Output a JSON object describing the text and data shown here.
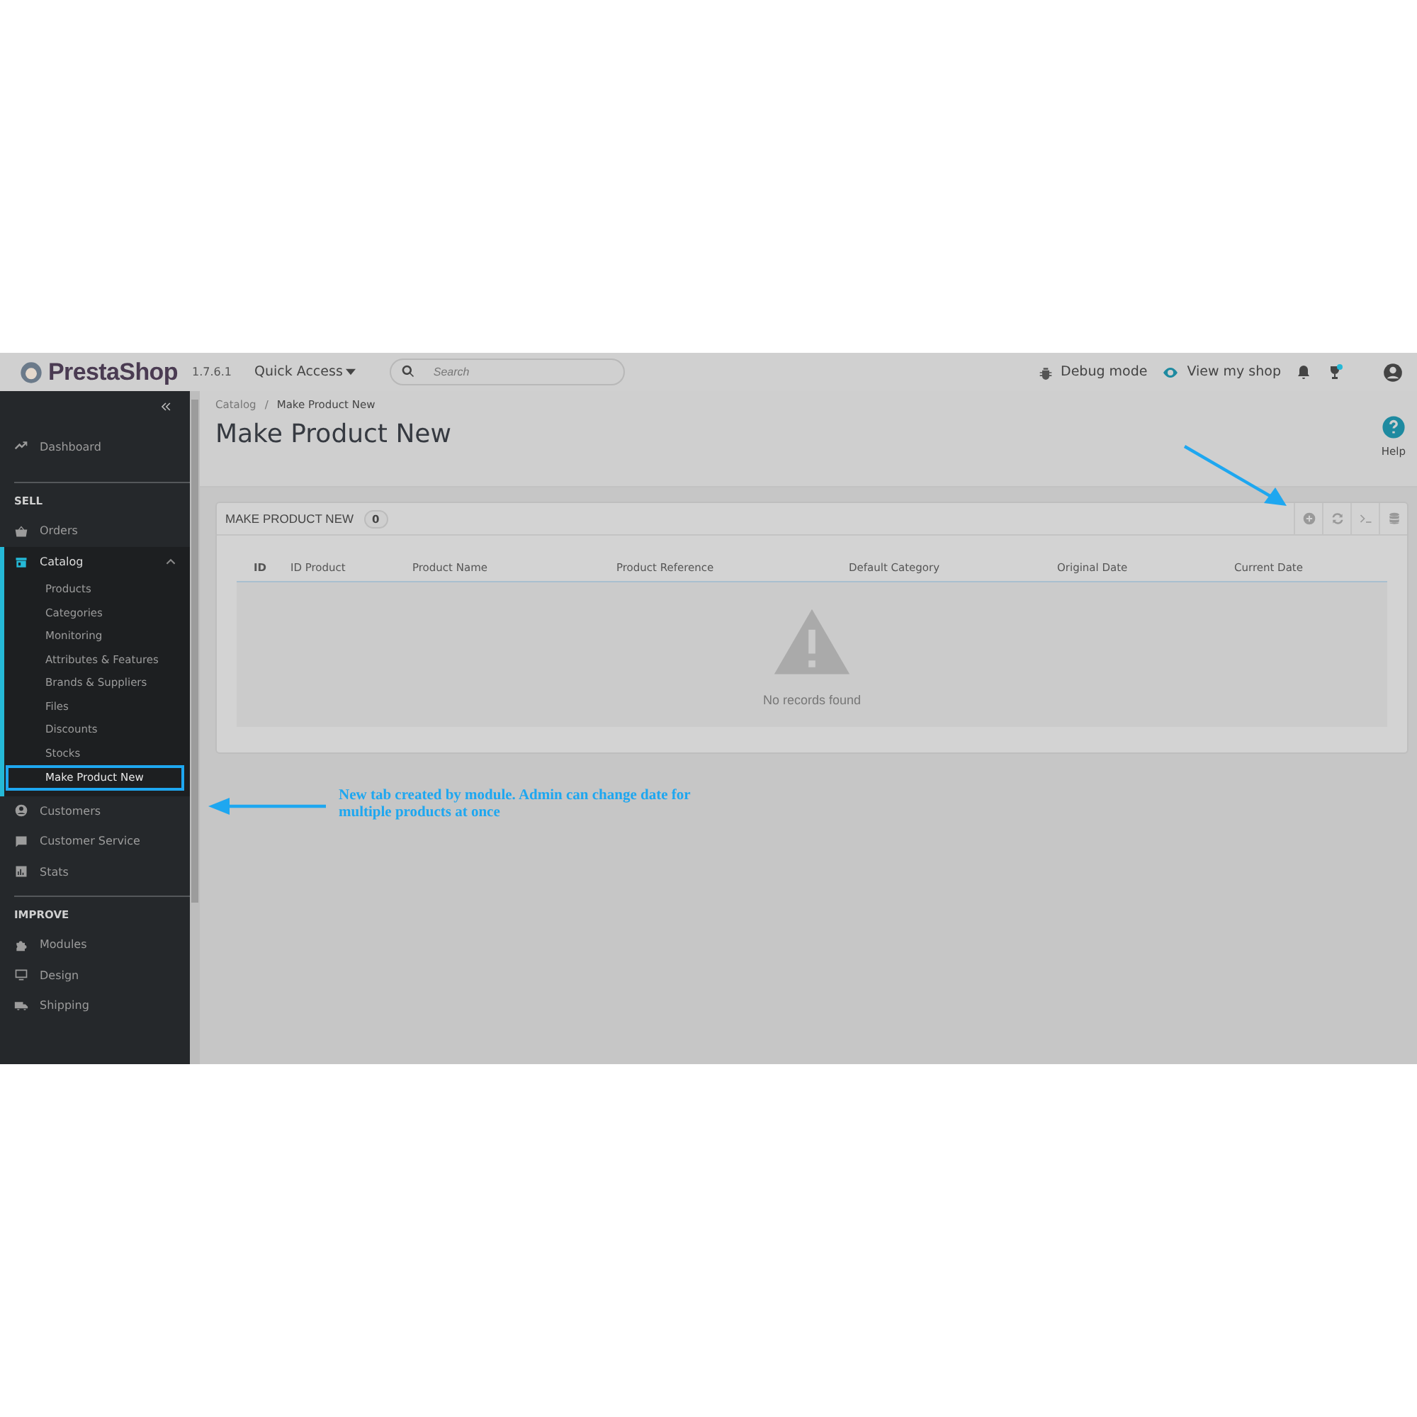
{
  "header": {
    "logo": "PrestaShop",
    "version": "1.7.6.1",
    "quick_access": "Quick Access",
    "search": {
      "placeholder": "Search"
    },
    "debug_mode": "Debug mode",
    "view_shop": "View my shop"
  },
  "sidebar": {
    "items": [
      {
        "kind": "link",
        "label": "Dashboard"
      },
      {
        "kind": "section",
        "label": "SELL"
      },
      {
        "kind": "link",
        "label": "Orders"
      },
      {
        "kind": "group",
        "label": "Catalog",
        "expanded": true,
        "selected": true,
        "children": [
          {
            "label": "Products",
            "selected": false
          },
          {
            "label": "Categories",
            "selected": false
          },
          {
            "label": "Monitoring",
            "selected": false
          },
          {
            "label": "Attributes & Features",
            "selected": false
          },
          {
            "label": "Brands & Suppliers",
            "selected": false
          },
          {
            "label": "Files",
            "selected": false
          },
          {
            "label": "Discounts",
            "selected": false
          },
          {
            "label": "Stocks",
            "selected": false
          },
          {
            "label": "Make Product New",
            "selected": true
          }
        ]
      },
      {
        "kind": "link",
        "label": "Customers"
      },
      {
        "kind": "link",
        "label": "Customer Service"
      },
      {
        "kind": "link",
        "label": "Stats"
      },
      {
        "kind": "section",
        "label": "IMPROVE"
      },
      {
        "kind": "link",
        "label": "Modules"
      },
      {
        "kind": "link",
        "label": "Design"
      },
      {
        "kind": "link",
        "label": "Shipping"
      }
    ]
  },
  "breadcrumb": [
    "Catalog",
    "Make Product New"
  ],
  "breadcrumb_separator": "/",
  "page_title": "Make Product New",
  "help": "Help",
  "panel": {
    "title": "MAKE PRODUCT NEW",
    "count": "0",
    "columns": [
      "ID",
      "ID Product",
      "Product Name",
      "Product Reference",
      "Default Category",
      "Original Date",
      "Current Date"
    ],
    "empty_message": "No records found"
  },
  "annotation": {
    "note": "New tab created by module. Admin can change date for multiple products at once"
  }
}
